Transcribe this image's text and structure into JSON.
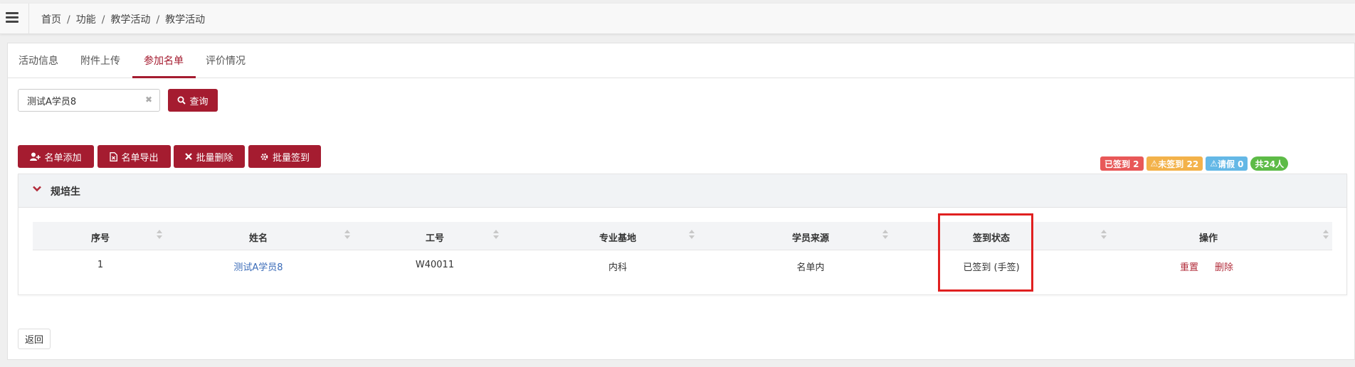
{
  "breadcrumb": [
    "首页",
    "功能",
    "教学活动",
    "教学活动"
  ],
  "tabs": [
    "活动信息",
    "附件上传",
    "参加名单",
    "评价情况"
  ],
  "active_tab": "参加名单",
  "search": {
    "value": "测试A学员8",
    "button_label": "查询"
  },
  "toolbar": {
    "add_label": "名单添加",
    "export_label": "名单导出",
    "batch_delete_label": "批量删除",
    "batch_signin_label": "批量签到"
  },
  "badges": {
    "signed": "已签到 2",
    "unsigned": "未签到 22",
    "leave": "请假 0",
    "total": "共24人"
  },
  "section": {
    "title": "规培生"
  },
  "table": {
    "headers": [
      "序号",
      "姓名",
      "工号",
      "专业基地",
      "学员来源",
      "签到状态",
      "操作"
    ],
    "rows": [
      {
        "index": "1",
        "name": "测试A学员8",
        "id": "W40011",
        "base": "内科",
        "source": "名单内",
        "status": "已签到 (手签)",
        "reset": "重置",
        "delete": "删除"
      }
    ]
  },
  "back_label": "返回",
  "colors": {
    "accent": "#a51c30",
    "link": "#3a6bb8",
    "highlight": "#e02020"
  }
}
